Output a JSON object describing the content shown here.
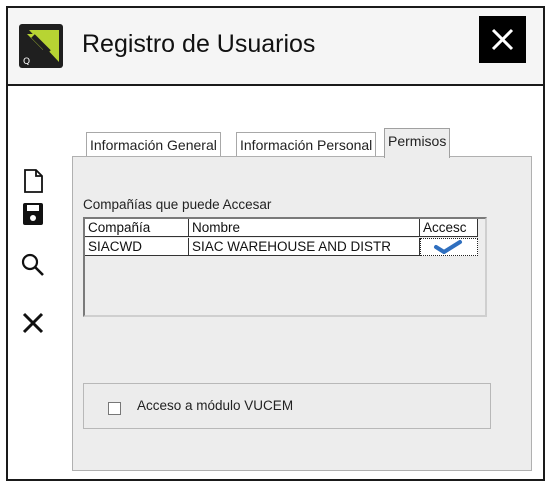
{
  "window": {
    "title": "Registro de Usuarios"
  },
  "icons": {
    "app": "app-logo-icon",
    "close": "close-icon",
    "new": "new-document-icon",
    "save": "save-floppy-icon",
    "search": "search-icon",
    "cancel": "cancel-x-icon"
  },
  "tabs": [
    {
      "label": "Información General"
    },
    {
      "label": "Información Personal"
    },
    {
      "label": "Permisos",
      "active": true
    }
  ],
  "permisos": {
    "companies_label": "Compañías que puede Accesar",
    "grid": {
      "columns": [
        "Compañía",
        "Nombre",
        "Accesc"
      ],
      "rows": [
        {
          "compania": "SIACWD",
          "nombre": "SIAC WAREHOUSE AND DISTR",
          "acceso": true
        }
      ]
    },
    "vucem": {
      "label": "Acceso a módulo VUCEM",
      "checked": false
    }
  },
  "colors": {
    "accent_green": "#b7d433",
    "check_blue": "#2f6fbf"
  }
}
